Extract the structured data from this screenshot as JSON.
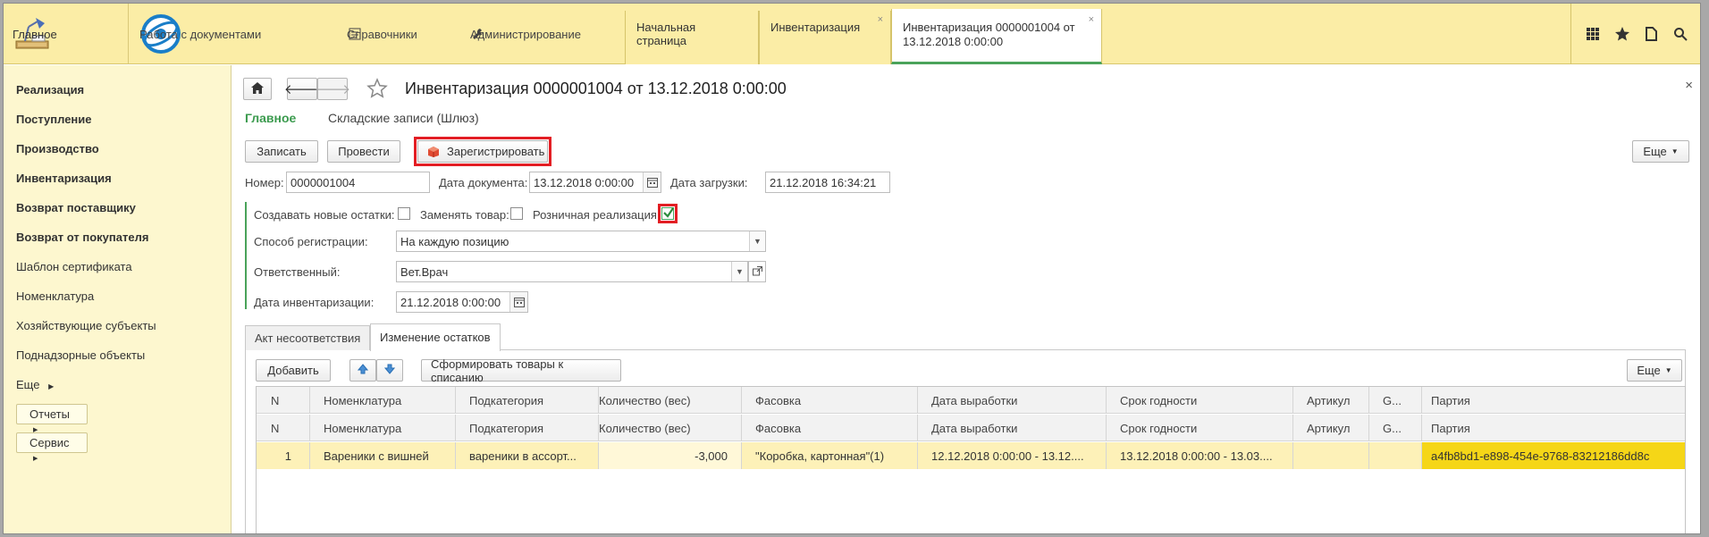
{
  "topbar": {
    "home_label": "Главное",
    "nav": [
      {
        "label": "Работа с документами"
      },
      {
        "label": "Справочники"
      },
      {
        "label": "Администрирование"
      }
    ],
    "tabs": [
      {
        "label": "Начальная страница"
      },
      {
        "label": "Инвентаризация"
      },
      {
        "label_line1": "Инвентаризация 0000001004 от",
        "label_line2": "13.12.2018 0:00:00"
      }
    ],
    "close_glyph": "×"
  },
  "sidebar": {
    "items": [
      {
        "label": "Реализация"
      },
      {
        "label": "Поступление"
      },
      {
        "label": "Производство"
      },
      {
        "label": "Инвентаризация"
      },
      {
        "label": "Возврат поставщику"
      },
      {
        "label": "Возврат от покупателя"
      },
      {
        "label": "Шаблон сертификата"
      },
      {
        "label": "Номенклатура"
      },
      {
        "label": "Хозяйствующие субъекты"
      },
      {
        "label": "Поднадзорные объекты"
      }
    ],
    "more_label": "Еще",
    "reports_label": "Отчеты",
    "service_label": "Сервис"
  },
  "document": {
    "title": "Инвентаризация 0000001004 от 13.12.2018 0:00:00",
    "section_main": "Главное",
    "section_link": "Складские записи (Шлюз)",
    "buttons": {
      "save": "Записать",
      "post": "Провести",
      "register": "Зарегистрировать",
      "more": "Еще"
    },
    "fields": {
      "number_label": "Номер:",
      "number_value": "0000001004",
      "doc_date_label": "Дата документа:",
      "doc_date_value": "13.12.2018  0:00:00",
      "load_date_label": "Дата загрузки:",
      "load_date_value": "21.12.2018 16:34:21",
      "create_new_label": "Создавать новые остатки:",
      "replace_label": "Заменять товар:",
      "retail_label": "Розничная реализация:",
      "reg_method_label": "Способ регистрации:",
      "reg_method_value": "На каждую позицию",
      "responsible_label": "Ответственный:",
      "responsible_value": "Вет.Врач",
      "inv_date_label": "Дата инвентаризации:",
      "inv_date_value": "21.12.2018  0:00:00"
    },
    "checkboxes": {
      "create_new": false,
      "replace": false,
      "retail": true
    },
    "tabs": [
      {
        "label": "Акт несоответствия"
      },
      {
        "label": "Изменение остатков"
      }
    ],
    "table_toolbar": {
      "add": "Добавить",
      "form_writeoff": "Сформировать товары к списанию",
      "more": "Еще"
    },
    "table": {
      "columns": [
        "N",
        "Номенклатура",
        "Подкатегория",
        "Количество (вес)",
        "Фасовка",
        "Дата выработки",
        "Срок годности",
        "Артикул",
        "G...",
        "Партия"
      ],
      "rows": [
        [
          "1",
          "Вареники с вишней",
          "вареники в ассорт...",
          "-3,000",
          "\"Коробка, картонная\"(1)",
          "12.12.2018 0:00:00 - 13.12....",
          "13.12.2018 0:00:00 - 13.03....",
          "",
          "",
          "a4fb8bd1-e898-454e-9768-83212186dd8c"
        ]
      ]
    }
  },
  "colors": {
    "topbar_bg": "#fbeda6",
    "sidebar_bg": "#fdf7cf",
    "accent_green": "#4aa35a",
    "highlight_red": "#e31e24",
    "selected_row": "#fdf1b8",
    "selected_cell": "#f5d617"
  }
}
